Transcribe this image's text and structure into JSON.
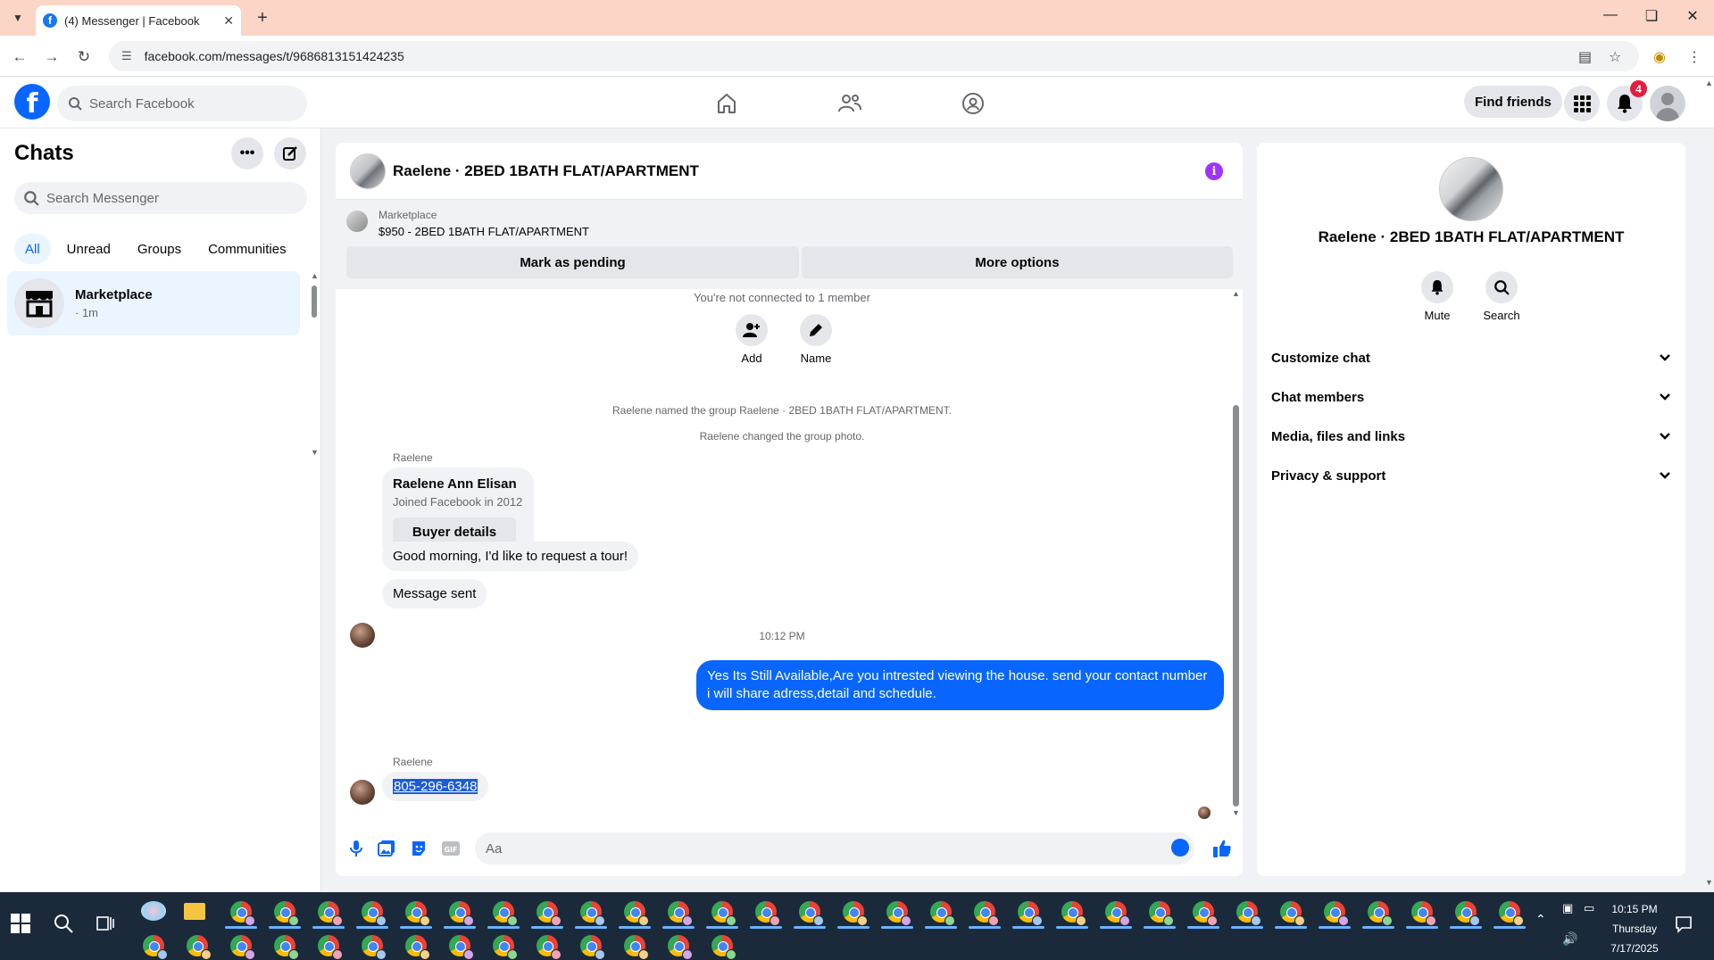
{
  "browser": {
    "tab_title": "(4) Messenger | Facebook",
    "url": "facebook.com/messages/t/9686813151424235"
  },
  "fb": {
    "search_placeholder": "Search Facebook",
    "find_friends": "Find friends",
    "notification_count": "4"
  },
  "sidebar": {
    "title": "Chats",
    "search_placeholder": "Search Messenger",
    "filters": [
      "All",
      "Unread",
      "Groups",
      "Communities"
    ],
    "active_filter": "All",
    "chats": [
      {
        "name": "Marketplace",
        "time": "· 1m"
      }
    ]
  },
  "conversation": {
    "title": "Raelene · 2BED 1BATH FLAT/APARTMENT",
    "marketplace": {
      "label": "Marketplace",
      "listing": "$950 - 2BED 1BATH FLAT/APARTMENT",
      "mark_pending": "Mark as pending",
      "more_options": "More options"
    },
    "not_connected": "You're not connected to 1 member",
    "actions": [
      {
        "label": "Add",
        "icon": "add-person-icon"
      },
      {
        "label": "Name",
        "icon": "pencil-icon"
      }
    ],
    "system_messages": [
      "Raelene named the group Raelene · 2BED 1BATH FLAT/APARTMENT.",
      "Raelene changed the group photo."
    ],
    "sender_name": "Raelene",
    "profile_card": {
      "name": "Raelene Ann Elisan",
      "joined": "Joined Facebook in 2012",
      "button": "Buyer details"
    },
    "messages": [
      {
        "from": "them",
        "text": "Good morning, I'd like to request a tour!"
      },
      {
        "from": "them",
        "text": "Message sent"
      },
      {
        "from": "me",
        "text": "Yes Its Still Available,Are you intrested viewing the house. send your contact number i will share adress,detail and schedule."
      },
      {
        "from": "them",
        "text": "805-296-6348"
      }
    ],
    "timestamp": "10:12 PM",
    "second_sender_name": "Raelene",
    "composer_placeholder": "Aa"
  },
  "info_pane": {
    "title": "Raelene · 2BED 1BATH FLAT/APARTMENT",
    "actions": [
      {
        "label": "Mute",
        "icon": "bell-icon"
      },
      {
        "label": "Search",
        "icon": "search-icon"
      }
    ],
    "sections": [
      "Customize chat",
      "Chat members",
      "Media, files and links",
      "Privacy & support"
    ]
  },
  "taskbar": {
    "time": "10:15 PM",
    "day": "Thursday",
    "date": "7/17/2025"
  }
}
